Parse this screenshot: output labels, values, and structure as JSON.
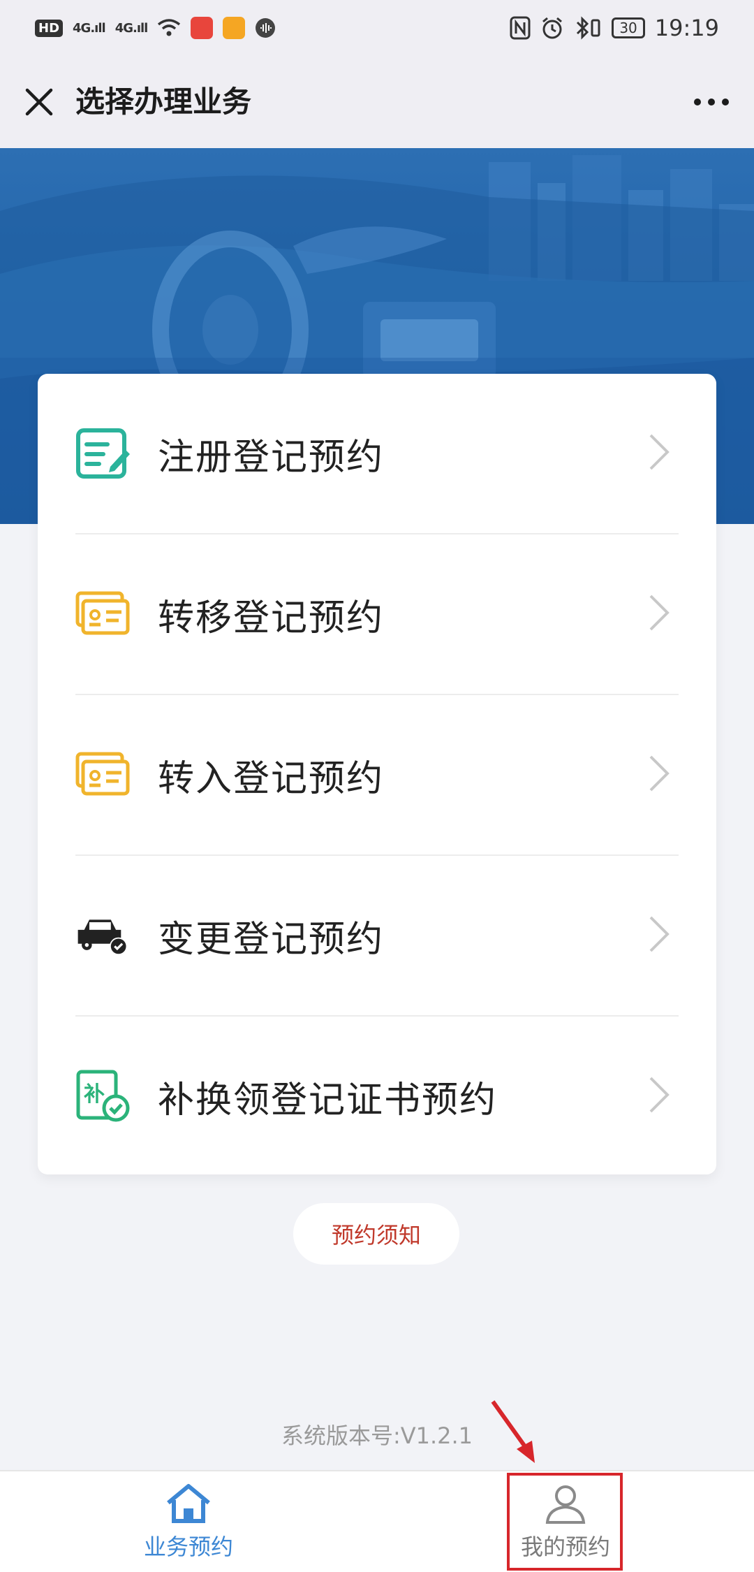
{
  "status_bar": {
    "left_chip": "HD",
    "signal1": "4G",
    "signal2": "4G",
    "battery": "30",
    "time": "19:19"
  },
  "header": {
    "title": "选择办理业务"
  },
  "menu": {
    "items": [
      {
        "label": "注册登记预约",
        "icon": "edit-form-icon",
        "color": "#2bb39b"
      },
      {
        "label": "转移登记预约",
        "icon": "id-card-icon",
        "color": "#f0b42c"
      },
      {
        "label": "转入登记预约",
        "icon": "id-card-icon",
        "color": "#f0b42c"
      },
      {
        "label": "变更登记预约",
        "icon": "car-check-icon",
        "color": "#222222"
      },
      {
        "label": "补换领登记证书预约",
        "icon": "certificate-check-icon",
        "color": "#2bb37a"
      }
    ]
  },
  "notice_button": "预约须知",
  "version_text": "系统版本号:V1.2.1",
  "tabbar": {
    "home_label": "业务预约",
    "mine_label": "我的预约",
    "active_color": "#3d87d4"
  },
  "annotation_color": "#d7262b"
}
